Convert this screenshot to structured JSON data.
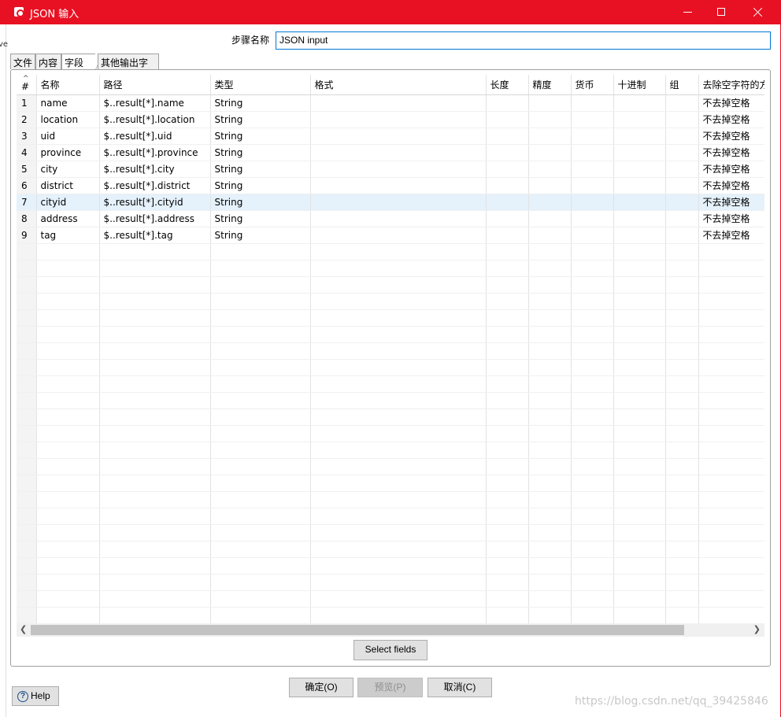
{
  "window": {
    "title": "JSON 输入",
    "min_label": "–",
    "max_label": "□",
    "close_label": "×",
    "edge_text": "ve"
  },
  "step": {
    "label": "步骤名称",
    "value": "JSON input"
  },
  "tabs": [
    {
      "label": "文件"
    },
    {
      "label": "内容"
    },
    {
      "label": "字段"
    },
    {
      "label": "其他输出字段"
    }
  ],
  "grid": {
    "columns": [
      "#",
      "名称",
      "路径",
      "类型",
      "格式",
      "长度",
      "精度",
      "货币",
      "十进制",
      "组",
      "去除空字符的方"
    ],
    "rows": [
      {
        "n": "1",
        "name": "name",
        "path": "$..result[*].name",
        "type": "String",
        "trim": "不去掉空格"
      },
      {
        "n": "2",
        "name": "location",
        "path": "$..result[*].location",
        "type": "String",
        "trim": "不去掉空格"
      },
      {
        "n": "3",
        "name": "uid",
        "path": "$..result[*].uid",
        "type": "String",
        "trim": "不去掉空格"
      },
      {
        "n": "4",
        "name": "province",
        "path": "$..result[*].province",
        "type": "String",
        "trim": "不去掉空格"
      },
      {
        "n": "5",
        "name": "city",
        "path": "$..result[*].city",
        "type": "String",
        "trim": "不去掉空格"
      },
      {
        "n": "6",
        "name": "district",
        "path": "$..result[*].district",
        "type": "String",
        "trim": "不去掉空格"
      },
      {
        "n": "7",
        "name": "cityid",
        "path": "$..result[*].cityid",
        "type": "String",
        "trim": "不去掉空格"
      },
      {
        "n": "8",
        "name": "address",
        "path": "$..result[*].address",
        "type": "String",
        "trim": "不去掉空格"
      },
      {
        "n": "9",
        "name": "tag",
        "path": "$..result[*].tag",
        "type": "String",
        "trim": "不去掉空格"
      }
    ],
    "selected_row": "7"
  },
  "buttons": {
    "select_fields": "Select fields",
    "ok": "确定(O)",
    "preview": "预览(P)",
    "cancel": "取消(C)",
    "help": "Help"
  },
  "watermark": "https://blog.csdn.net/qq_39425846",
  "colors": {
    "titlebar": "#e81123",
    "selected_row": "#e5f1fb",
    "input_border": "#0078d7"
  }
}
